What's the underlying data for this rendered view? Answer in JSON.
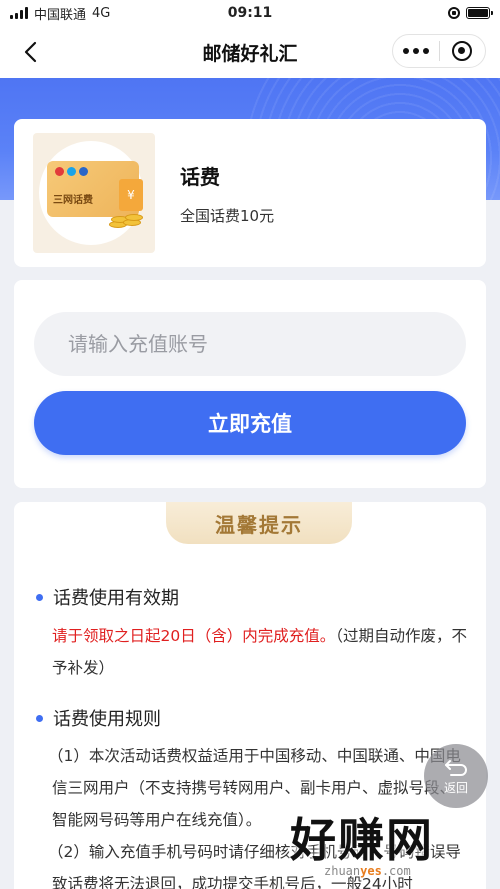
{
  "status_bar": {
    "carrier": "中国联通",
    "network": "4G",
    "time": "09:11"
  },
  "nav": {
    "title": "邮储好礼汇"
  },
  "product": {
    "name": "话费",
    "description": "全国话费10元",
    "thumb_label": "三网话费",
    "thumb_symbol": "¥"
  },
  "recharge": {
    "input_placeholder": "请输入充值账号",
    "input_value": "",
    "button_label": "立即充值"
  },
  "tips": {
    "badge": "温馨提示",
    "sections": [
      {
        "heading": "话费使用有效期",
        "highlight": "请于领取之日起20日（含）内完成充值。",
        "text_after": "（过期自动作废，不予补发）"
      },
      {
        "heading": "话费使用规则",
        "rule_1": "（1）本次活动话费权益适用于中国移动、中国联通、中国电信三网用户（不支持携号转网用户、副卡用户、虚拟号段、智能网号码等用户在线充值）。",
        "rule_2": "（2）输入充值手机号码时请仔细核对手机号码，号码错误导致话费将无法退回，成功提交手机号后，一般24小时"
      }
    ]
  },
  "float_button": {
    "label": "返回"
  },
  "watermark": {
    "main": "好赚网",
    "site_prefix": "zhuan",
    "site_highlight": "yes",
    "site_suffix": ".com"
  },
  "colors": {
    "accent": "#3f6ef2",
    "banner": "#5b82f7",
    "warning": "#e02020",
    "badge_text": "#a37836"
  }
}
